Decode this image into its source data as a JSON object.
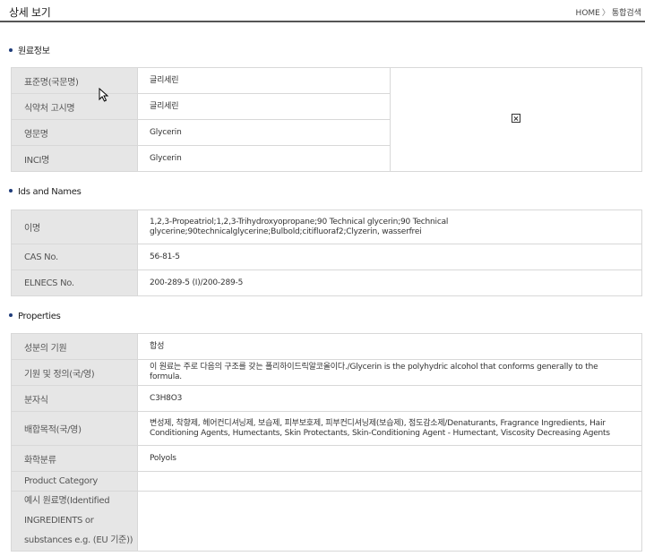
{
  "header": {
    "title": "상세 보기",
    "breadcrumb_home": "HOME",
    "breadcrumb_sep": "〉",
    "breadcrumb_current": "통합검색"
  },
  "sections": {
    "raw_info": {
      "title": "원료정보",
      "rows": [
        {
          "label": "표준명(국문명)",
          "value": "글리세린"
        },
        {
          "label": "식약처 고시명",
          "value": "글리세린"
        },
        {
          "label": "영문명",
          "value": "Glycerin"
        },
        {
          "label": "INCI명",
          "value": "Glycerin"
        }
      ]
    },
    "ids": {
      "title": "Ids and Names",
      "rows": [
        {
          "label": "이명",
          "value": "1,2,3-Propeatriol;1,2,3-Trihydroxyopropane;90 Technical glycerin;90 Technical glycerine;90technicalglycerine;Bulbold;citifluoraf2;Clyzerin, wasserfrei"
        },
        {
          "label": "CAS No.",
          "value": "56-81-5"
        },
        {
          "label": "ELNECS No.",
          "value": "200-289-5 (I)/200-289-5"
        }
      ]
    },
    "properties": {
      "title": "Properties",
      "rows": [
        {
          "label": "성분의 기원",
          "value": "합성"
        },
        {
          "label": "기원 및 정의(국/영)",
          "value": "이 원료는 주로 다음의 구조를 갖는 폴리하이드릭알코올이다./Glycerin is the polyhydric alcohol that conforms generally to the formula."
        },
        {
          "label": "분자식",
          "value": "C3H8O3"
        },
        {
          "label": "배합목적(국/영)",
          "value": "변성제, 착향제, 헤어컨디셔닝제, 보습제, 피부보호제, 피부컨디셔닝제(보습제), 점도감소제/Denaturants, Fragrance Ingredients, Hair Conditioning Agents, Humectants, Skin Protectants, Skin-Conditioning Agent - Humectant, Viscosity Decreasing Agents"
        },
        {
          "label": "화학분류",
          "value": "Polyols"
        },
        {
          "label": "Product Category",
          "value": ""
        },
        {
          "label": "예시 원료명(Identified INGREDIENTS or substances e.g. (EU 기준))",
          "value": ""
        }
      ]
    }
  },
  "icons": {
    "broken_image": "broken-image-icon",
    "cursor": "mouse-pointer-icon"
  },
  "colors": {
    "label_bg": "#e6e6e6",
    "border": "#d8d8d8",
    "bullet": "#1f3c7a"
  }
}
